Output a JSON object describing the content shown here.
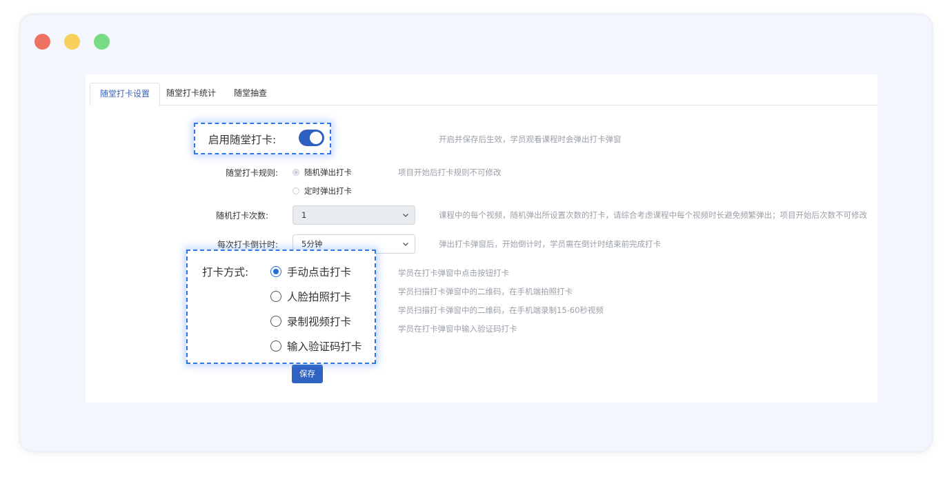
{
  "tabs": [
    {
      "label": "随堂打卡设置",
      "active": true
    },
    {
      "label": "随堂打卡统计",
      "active": false
    },
    {
      "label": "随堂抽查",
      "active": false
    }
  ],
  "enable": {
    "label": "启用随堂打卡:",
    "on": true,
    "hint": "开启并保存后生效，学员观看课程时会弹出打卡弹窗"
  },
  "rule": {
    "label": "随堂打卡规则:",
    "options": [
      "随机弹出打卡",
      "定时弹出打卡"
    ],
    "selected": 0,
    "hint": "项目开始后打卡规则不可修改"
  },
  "random_count": {
    "label": "随机打卡次数:",
    "value": "1",
    "hint": "课程中的每个视频，随机弹出所设置次数的打卡，请综合考虑课程中每个视频时长避免频繁弹出；项目开始后次数不可修改"
  },
  "countdown": {
    "label": "每次打卡倒计时:",
    "value": "5分钟",
    "hint": "弹出打卡弹窗后，开始倒计时，学员需在倒计时结束前完成打卡"
  },
  "method": {
    "label": "打卡方式:",
    "options": [
      "手动点击打卡",
      "人脸拍照打卡",
      "录制视频打卡",
      "输入验证码打卡"
    ],
    "selected": 0,
    "hints": [
      "学员在打卡弹窗中点击按钮打卡",
      "学员扫描打卡弹窗中的二维码，在手机端拍照打卡",
      "学员扫描打卡弹窗中的二维码，在手机端录制15-60秒视频",
      "学员在打卡弹窗中输入验证码打卡"
    ]
  },
  "save_label": "保存",
  "colors": {
    "accent": "#2e62c3",
    "highlight_border": "#2f72ea"
  }
}
